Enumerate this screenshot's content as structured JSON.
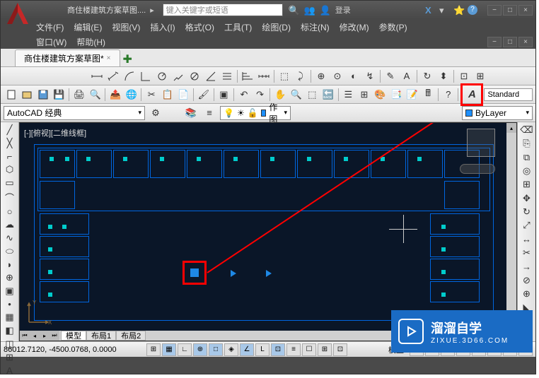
{
  "title": {
    "app_name": "AutoCAD",
    "document": "商住楼建筑方案草图....",
    "search_placeholder": "键入关键字或短语",
    "login": "登录"
  },
  "menus": {
    "file": "文件(F)",
    "edit": "编辑(E)",
    "view": "视图(V)",
    "insert": "插入(I)",
    "format": "格式(O)",
    "tools": "工具(T)",
    "draw": "绘图(D)",
    "dimension": "标注(N)",
    "modify": "修改(M)",
    "parametric": "参数(P)",
    "window": "窗口(W)",
    "help": "帮助(H)"
  },
  "tab": {
    "name": "商住楼建筑方案草图*"
  },
  "workspace": {
    "selected": "AutoCAD 经典"
  },
  "layer": {
    "current": "作图",
    "color_prop": "ByLayer"
  },
  "text_style": {
    "standard": "Standard"
  },
  "viewport": {
    "label": "[-][俯视][二维线框]"
  },
  "layout_tabs": {
    "model": "模型",
    "layout1": "布局1",
    "layout2": "布局2"
  },
  "status": {
    "coords": "86012.7120, -4500.0768, 0.0000",
    "model": "模型"
  },
  "watermark": {
    "title": "溜溜自学",
    "url": "ZIXUE.3D66.COM"
  },
  "icons": {
    "search": "🔍",
    "people": "👥",
    "signin": "👤",
    "exchange": "X",
    "help": "?",
    "minimize": "−",
    "maximize": "□",
    "close": "×",
    "arrow": "▸",
    "dropdown": "▾",
    "sun": "☀",
    "bulb": "💡",
    "lock": "🔒",
    "play": "▷"
  }
}
